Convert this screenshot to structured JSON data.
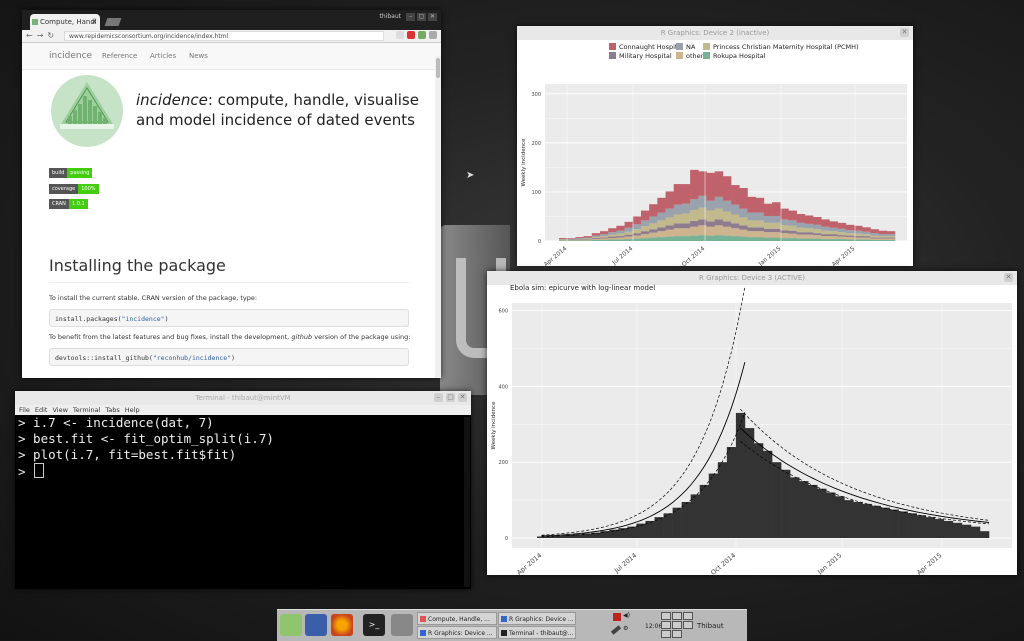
{
  "browser": {
    "tab_title": "Compute, Handl",
    "user": "thibaut",
    "url": "www.repidemicsconsortium.org/incidence/index.html",
    "nav": {
      "brand": "incidence",
      "links": [
        "Reference",
        "Articles",
        "News"
      ]
    },
    "tagline_em": "incidence",
    "tagline_rest": ": compute, handle, visualise",
    "tagline_line2": "and model incidence of dated events",
    "badges": [
      {
        "k": "build",
        "v": "passing"
      },
      {
        "k": "coverage",
        "v": "100%"
      },
      {
        "k": "CRAN",
        "v": "1.0.1"
      }
    ],
    "heading": "Installing the package",
    "para1": "To install the current stable, CRAN version of the package, type:",
    "code1_fn": "install.packages(",
    "code1_str": "\"incidence\"",
    "code1_end": ")",
    "para2_a": "To benefit from the latest features and bug fixes, install the development, ",
    "para2_em": "github",
    "para2_b": " version of the package using:",
    "code2_fn": "devtools::install_github(",
    "code2_str": "\"reconhub/incidence\"",
    "code2_end": ")"
  },
  "gfx2": {
    "title": "R Graphics: Device 2 (inactive)",
    "legend": [
      "Connaught Hospital",
      "NA",
      "Princess Christian Maternity Hospital (PCMH)",
      "Military Hospital",
      "other",
      "Rokupa Hospital"
    ],
    "legend_colors": [
      "#c0626b",
      "#9aa3ad",
      "#c2b98d",
      "#8f7b8e",
      "#cdb48e",
      "#78b296"
    ],
    "ylabel": "Weekly incidence",
    "yticks": [
      "0",
      "100",
      "200",
      "300"
    ],
    "xticks": [
      "Apr 2014",
      "Jul 2014",
      "Oct 2014",
      "Jan 2015",
      "Apr 2015"
    ]
  },
  "gfx3": {
    "title": "R Graphics: Device 3 (ACTIVE)",
    "chart_title": "Ebola sim: epicurve with log-linear model",
    "ylabel": "Weekly incidence",
    "yticks": [
      "0",
      "200",
      "400",
      "600"
    ],
    "xticks": [
      "Apr 2014",
      "Jul 2014",
      "Oct 2014",
      "Jan 2015",
      "Apr 2015"
    ]
  },
  "chart_data": [
    {
      "type": "bar",
      "stacked": true,
      "title": "",
      "ylabel": "Weekly incidence",
      "ylim": [
        0,
        320
      ],
      "x_start": "2014-04-07",
      "series": [
        {
          "name": "Connaught Hospital",
          "values": [
            2,
            1,
            2,
            3,
            5,
            6,
            8,
            10,
            12,
            16,
            20,
            25,
            30,
            35,
            42,
            40,
            60,
            50,
            57,
            52,
            50,
            40,
            42,
            32,
            30,
            25,
            28,
            22,
            20,
            18,
            17,
            16,
            15,
            13,
            12,
            11,
            10,
            9,
            8,
            7,
            6
          ]
        },
        {
          "name": "NA",
          "values": [
            1,
            1,
            2,
            2,
            3,
            4,
            5,
            6,
            8,
            10,
            12,
            14,
            16,
            18,
            20,
            20,
            22,
            24,
            20,
            24,
            22,
            20,
            18,
            16,
            16,
            14,
            14,
            12,
            11,
            10,
            9,
            9,
            8,
            7,
            7,
            6,
            6,
            5,
            5,
            4,
            4
          ]
        },
        {
          "name": "Princess Christian Maternity Hospital (PCMH)",
          "values": [
            1,
            1,
            1,
            2,
            2,
            3,
            4,
            5,
            6,
            8,
            10,
            12,
            14,
            16,
            18,
            20,
            22,
            24,
            22,
            22,
            20,
            18,
            16,
            14,
            14,
            12,
            12,
            10,
            10,
            9,
            8,
            8,
            7,
            6,
            6,
            5,
            5,
            4,
            4,
            3,
            3
          ]
        },
        {
          "name": "Military Hospital",
          "values": [
            0,
            1,
            1,
            1,
            2,
            2,
            3,
            3,
            4,
            5,
            6,
            7,
            8,
            9,
            10,
            10,
            12,
            12,
            11,
            12,
            11,
            10,
            9,
            8,
            8,
            7,
            7,
            6,
            6,
            5,
            5,
            4,
            4,
            4,
            3,
            3,
            3,
            3,
            2,
            2,
            2
          ]
        },
        {
          "name": "other",
          "values": [
            1,
            1,
            1,
            1,
            2,
            3,
            3,
            4,
            5,
            6,
            8,
            10,
            12,
            14,
            16,
            16,
            18,
            20,
            18,
            20,
            18,
            16,
            14,
            12,
            12,
            11,
            11,
            10,
            9,
            8,
            8,
            7,
            6,
            6,
            5,
            5,
            4,
            4,
            3,
            3,
            3
          ]
        },
        {
          "name": "Rokupa Hospital",
          "values": [
            1,
            1,
            1,
            1,
            2,
            2,
            3,
            3,
            4,
            5,
            6,
            7,
            8,
            9,
            10,
            10,
            11,
            12,
            11,
            12,
            11,
            10,
            9,
            8,
            8,
            7,
            7,
            6,
            6,
            5,
            5,
            5,
            4,
            4,
            4,
            3,
            3,
            3,
            2,
            2,
            2
          ]
        }
      ],
      "xticks": [
        "Apr 2014",
        "Jul 2014",
        "Oct 2014",
        "Jan 2015",
        "Apr 2015"
      ]
    },
    {
      "type": "bar",
      "title": "Ebola sim: epicurve with log-linear model",
      "ylabel": "Weekly incidence",
      "ylim": [
        0,
        600
      ],
      "values": [
        4,
        5,
        6,
        8,
        10,
        12,
        14,
        18,
        22,
        26,
        30,
        38,
        45,
        55,
        65,
        80,
        95,
        115,
        140,
        170,
        200,
        240,
        330,
        290,
        250,
        230,
        200,
        180,
        160,
        150,
        140,
        130,
        120,
        110,
        100,
        95,
        90,
        85,
        80,
        75,
        70,
        65,
        60,
        55,
        50,
        45,
        40,
        35,
        30,
        18
      ],
      "xticks": [
        "Apr 2014",
        "Jul 2014",
        "Oct 2014",
        "Jan 2015",
        "Apr 2015"
      ]
    }
  ],
  "terminal": {
    "title": "Terminal - thibaut@mintVM",
    "menu": [
      "File",
      "Edit",
      "View",
      "Terminal",
      "Tabs",
      "Help"
    ],
    "lines": [
      "> i.7 <- incidence(dat, 7)",
      "> best.fit <- fit_optim_split(i.7)",
      "> plot(i.7, fit=best.fit$fit)",
      "> "
    ]
  },
  "taskbar": {
    "buttons": [
      "Compute, Handle, ...",
      "R Graphics: Device ...",
      "R Graphics: Device ...",
      "Terminal - thibaut@..."
    ],
    "clock": "12:06",
    "user": "Thibaut"
  }
}
